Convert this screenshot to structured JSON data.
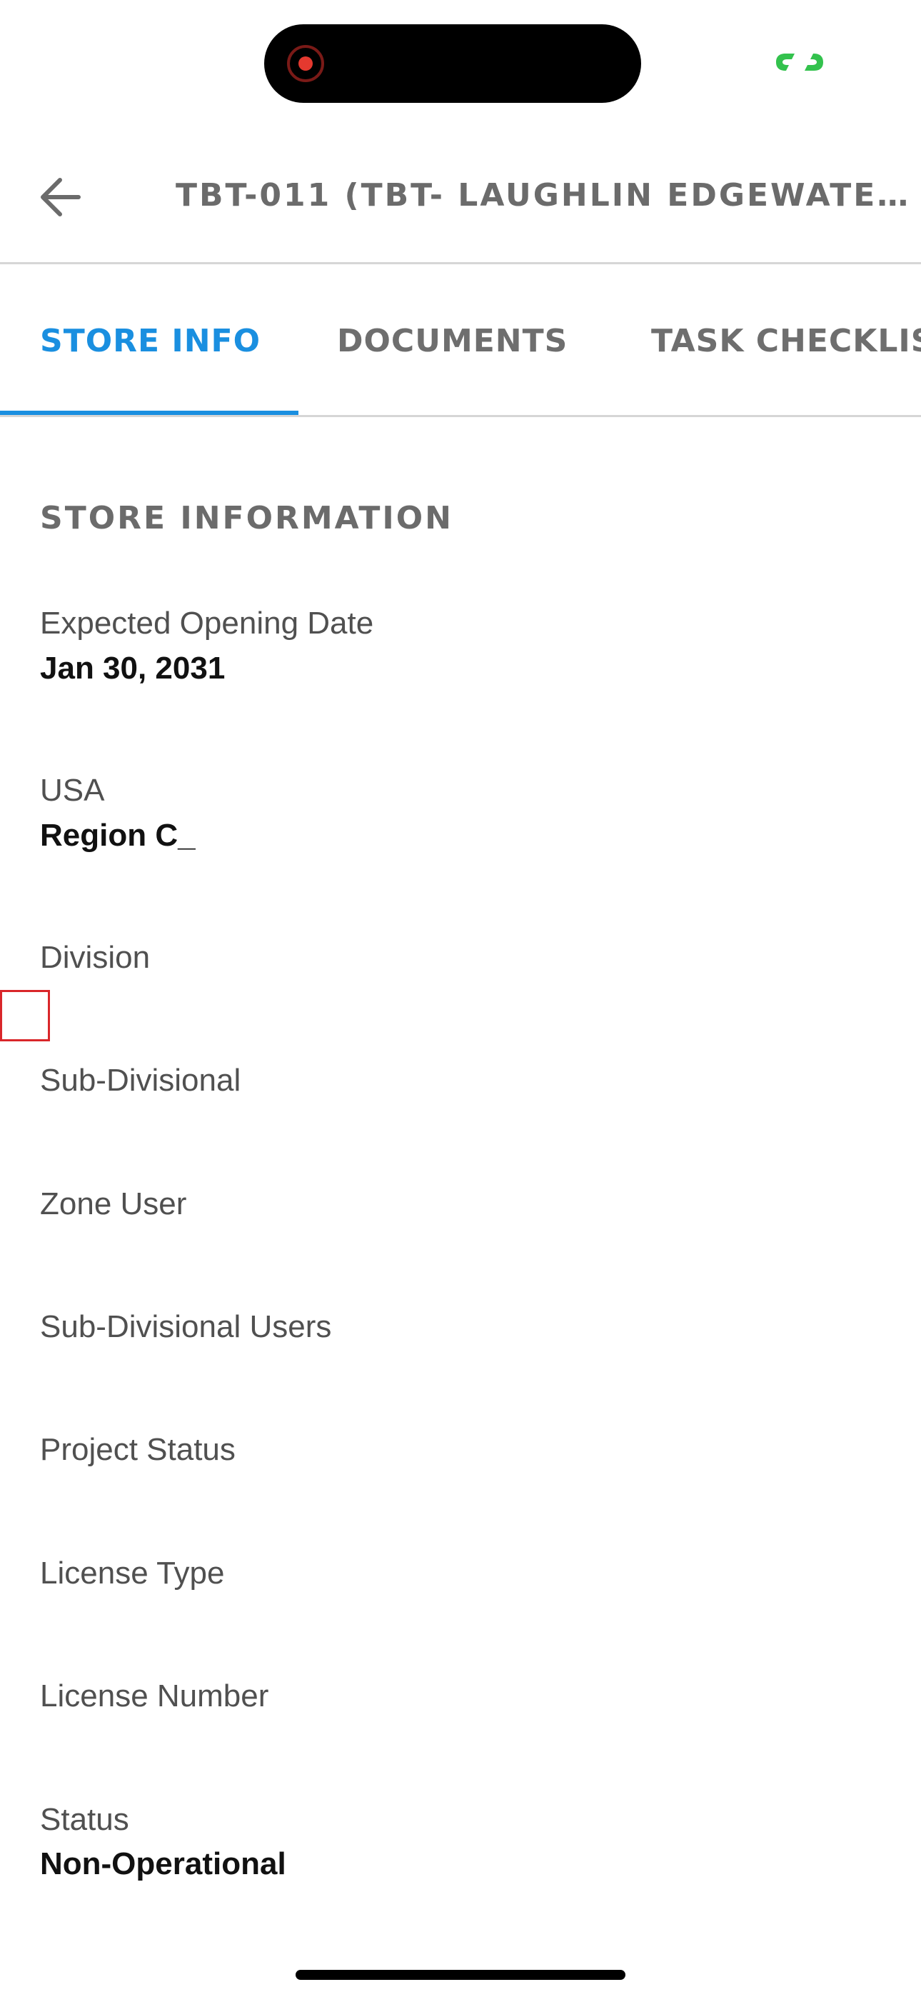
{
  "colors": {
    "accent": "#1a8fe0",
    "recording_dot": "#e5392f",
    "link_icon": "#33c24d",
    "highlight_box": "#d9262a"
  },
  "header": {
    "title": "TBT-011 (TBT- LAUGHLIN EDGEWATE…",
    "back_icon": "arrow-left-icon"
  },
  "tabs": [
    {
      "label": "STORE INFO",
      "active": true
    },
    {
      "label": "DOCUMENTS",
      "active": false
    },
    {
      "label": "TASK CHECKLIS",
      "active": false
    }
  ],
  "section": {
    "title": "STORE INFORMATION",
    "fields": [
      {
        "label": "Expected Opening Date",
        "value": "Jan 30, 2031"
      },
      {
        "label": "USA",
        "value": "Region C_"
      },
      {
        "label": "Division",
        "value": ""
      },
      {
        "label": "Sub-Divisional",
        "value": ""
      },
      {
        "label": "Zone User",
        "value": ""
      },
      {
        "label": "Sub-Divisional Users",
        "value": ""
      },
      {
        "label": "Project Status",
        "value": ""
      },
      {
        "label": "License Type",
        "value": ""
      },
      {
        "label": "License Number",
        "value": ""
      },
      {
        "label": "Status",
        "value": "Non-Operational"
      }
    ]
  }
}
